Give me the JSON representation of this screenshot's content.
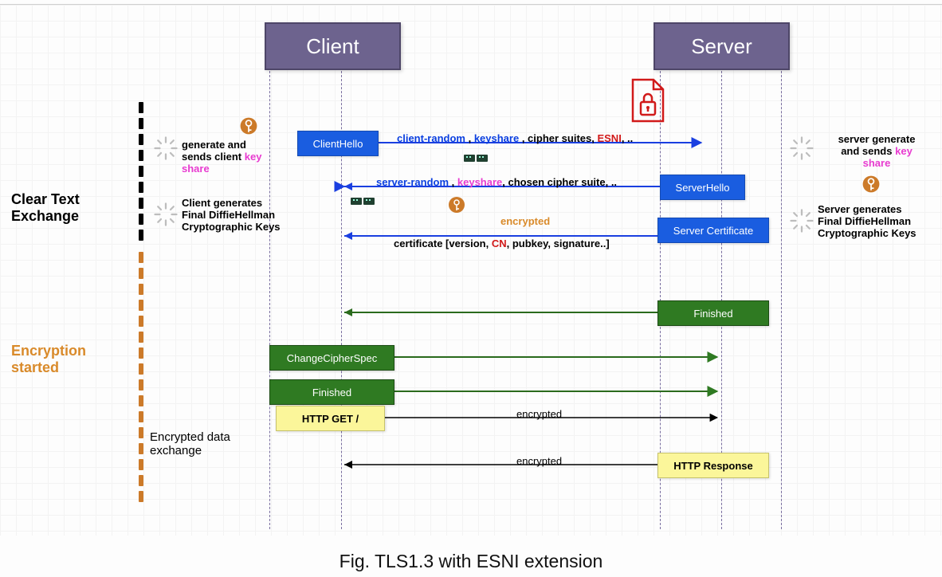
{
  "caption": "Fig. TLS1.3 with ESNI extension",
  "actors": {
    "client": "Client",
    "server": "Server"
  },
  "sections": {
    "clear": "Clear Text\nExchange",
    "encryption": "Encryption\nstarted",
    "encryptedData": "Encrypted data\nexchange"
  },
  "annotations": {
    "clientGenSend": {
      "pre": "generate and\nsends client ",
      "highlight": "key\nshare"
    },
    "clientFinalDH": "Client generates\nFinal DiffieHellman\nCryptographic Keys",
    "serverGenSend": {
      "pre": "server generate\nand sends ",
      "highlight": "key\nshare"
    },
    "serverFinalDH": "Server generates\nFinal DiffieHellman\nCryptographic Keys"
  },
  "boxes": {
    "clientHello": "ClientHello",
    "serverHello": "ServerHello",
    "serverCert": "Server Certificate",
    "finishedServer": "Finished",
    "changeCipher": "ChangeCipherSpec",
    "finishedClient": "Finished",
    "httpGet": "HTTP GET /",
    "httpResp": "HTTP Response"
  },
  "arrows": {
    "a1": {
      "parts": [
        {
          "text": "client-random ",
          "cls": "blue-txt bold"
        },
        {
          "text": ", ",
          "cls": "bold"
        },
        {
          "text": "keyshare ",
          "cls": "blue-txt bold"
        },
        {
          "text": ", cipher suites, ",
          "cls": "bold"
        },
        {
          "text": "ESNI",
          "cls": "red-txt bold"
        },
        {
          "text": ", ..",
          "cls": "bold"
        }
      ]
    },
    "a2": {
      "parts": [
        {
          "text": "server-random ",
          "cls": "blue-txt bold"
        },
        {
          "text": ", ",
          "cls": "bold"
        },
        {
          "text": "keyshare",
          "cls": "pink-txt bold"
        },
        {
          "text": ", chosen cipher suite, ..",
          "cls": ""
        }
      ]
    },
    "a3top": "encrypted",
    "a3": {
      "parts": [
        {
          "text": "certificate [version, ",
          "cls": ""
        },
        {
          "text": "CN",
          "cls": "red-txt bold"
        },
        {
          "text": ", pubkey, signature..]",
          "cls": ""
        }
      ]
    },
    "a5": "encrypted",
    "a6": "encrypted"
  }
}
